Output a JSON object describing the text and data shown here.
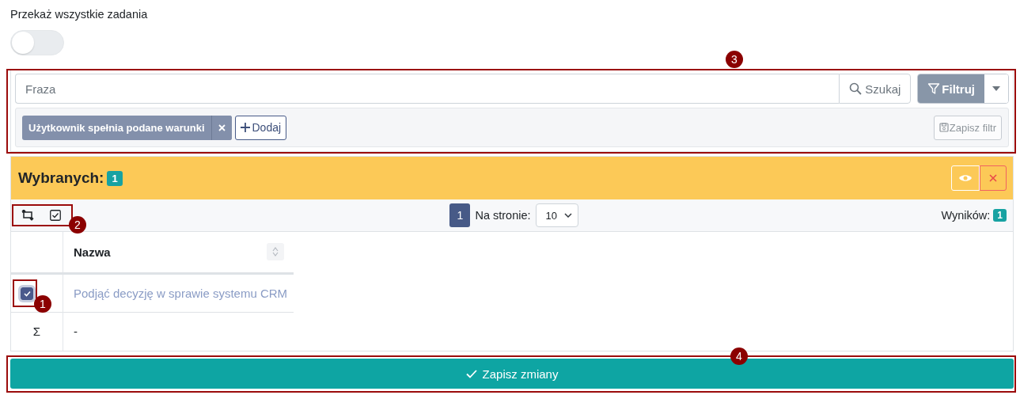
{
  "transfer_all": {
    "label": "Przekaż wszystkie zadania",
    "on": false
  },
  "filter": {
    "search": {
      "placeholder": "Fraza"
    },
    "search_button": "Szukaj",
    "filter_button": "Filtruj",
    "conditions": [
      {
        "label": "Użytkownik spełnia podane warunki"
      }
    ],
    "add_button": "Dodaj",
    "save_filter_button": {
      "label": "Zapisz filtr",
      "disabled": true
    }
  },
  "selection": {
    "label": "Wybranych:",
    "count": "1"
  },
  "toolbar": {
    "page": "1",
    "per_page_label": "Na stronie:",
    "per_page": "10",
    "results_label": "Wyników:",
    "results": "1"
  },
  "table": {
    "columns": [
      "Nazwa"
    ],
    "rows": [
      {
        "name": "Podjąć decyzję w sprawie systemu CRM",
        "selected": true
      }
    ],
    "summary": {
      "symbol": "Σ",
      "value": "-"
    }
  },
  "save_button": "Zapisz zmiany",
  "annotations": [
    "1",
    "2",
    "3",
    "4"
  ]
}
